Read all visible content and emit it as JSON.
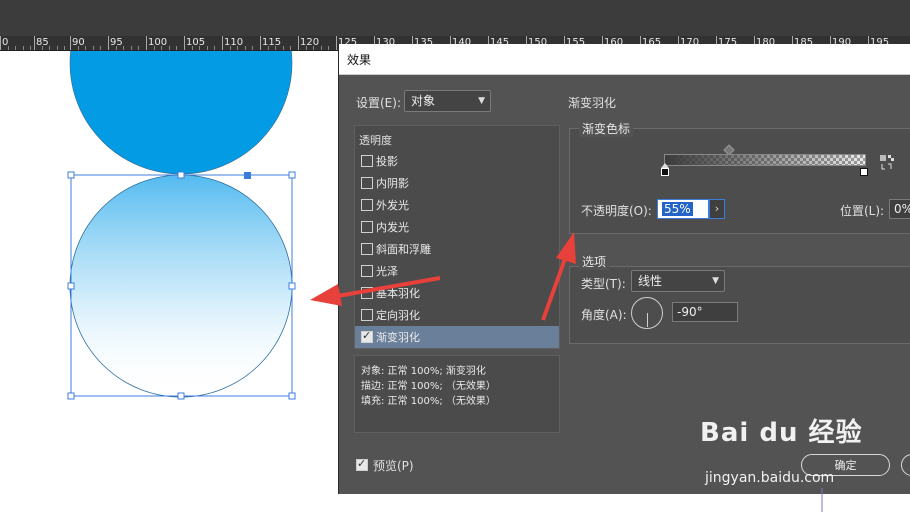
{
  "dialog": {
    "title": "效果",
    "settings_label": "设置(E):",
    "settings_value": "对象",
    "section_title": "渐变羽化",
    "effects_header": "透明度",
    "effects": [
      {
        "label": "投影",
        "checked": false,
        "selected": false
      },
      {
        "label": "内阴影",
        "checked": false,
        "selected": false
      },
      {
        "label": "外发光",
        "checked": false,
        "selected": false
      },
      {
        "label": "内发光",
        "checked": false,
        "selected": false
      },
      {
        "label": "斜面和浮雕",
        "checked": false,
        "selected": false
      },
      {
        "label": "光泽",
        "checked": false,
        "selected": false
      },
      {
        "label": "基本羽化",
        "checked": false,
        "selected": false
      },
      {
        "label": "定向羽化",
        "checked": false,
        "selected": false
      },
      {
        "label": "渐变羽化",
        "checked": true,
        "selected": true
      }
    ],
    "summary": [
      "对象: 正常 100%; 渐变羽化",
      "描边: 正常 100%; （无效果）",
      "填充: 正常 100%; （无效果）"
    ],
    "gradient_stops_title": "渐变色标",
    "opacity_label": "不透明度(O):",
    "opacity_value": "55%",
    "position_label": "位置(L):",
    "position_value": "0%",
    "options_title": "选项",
    "type_label": "类型(T):",
    "type_value": "线性",
    "angle_label": "角度(A):",
    "angle_value": "-90°",
    "preview_label": "预览(P)",
    "preview_checked": true,
    "ok_label": "确定"
  },
  "ruler": {
    "labels": [
      "0",
      "85",
      "90",
      "95",
      "100",
      "105",
      "110",
      "115",
      "120",
      "125",
      "130",
      "135",
      "140",
      "145",
      "150",
      "155",
      "160",
      "165",
      "170",
      "175",
      "180",
      "185",
      "190",
      "195"
    ]
  },
  "colors": {
    "dialog_bg": "#535353",
    "selection_blue": "#3b7ddd",
    "circle_top": "#0a9be6",
    "arrow_red": "#e8403a"
  },
  "watermark": {
    "brand": "Bai du 经验",
    "url": "jingyan.baidu.com"
  }
}
